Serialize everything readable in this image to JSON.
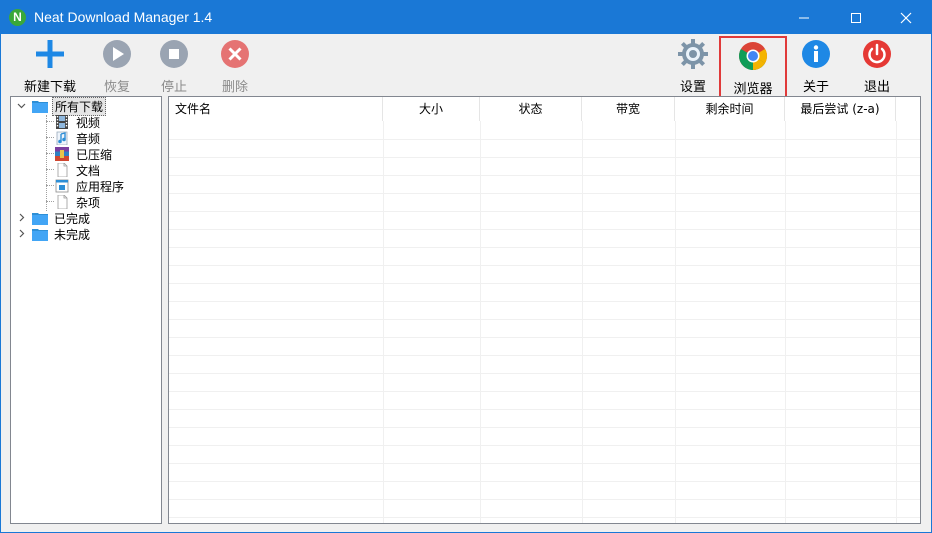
{
  "window": {
    "title": "Neat Download Manager 1.4",
    "app_icon_letter": "N"
  },
  "toolbar": {
    "new_download": "新建下载",
    "resume": "恢复",
    "stop": "停止",
    "delete": "删除",
    "settings": "设置",
    "browser": "浏览器",
    "about": "关于",
    "exit": "退出"
  },
  "tree": {
    "all_downloads": "所有下载",
    "video": "视频",
    "audio": "音频",
    "compressed": "已压缩",
    "documents": "文档",
    "applications": "应用程序",
    "misc": "杂项",
    "completed": "已完成",
    "incomplete": "未完成"
  },
  "list": {
    "columns": [
      "文件名",
      "大小",
      "状态",
      "带宽",
      "剩余时间",
      "最后尝试 (z-a)"
    ]
  },
  "colors": {
    "titlebar": "#1a78d6",
    "highlight_border": "#e03a3a",
    "add_blue": "#1e88e5",
    "disabled_gray": "#9aa4b2",
    "delete_red": "#e57373",
    "exit_red": "#e53935",
    "about_blue": "#1e88e5"
  }
}
